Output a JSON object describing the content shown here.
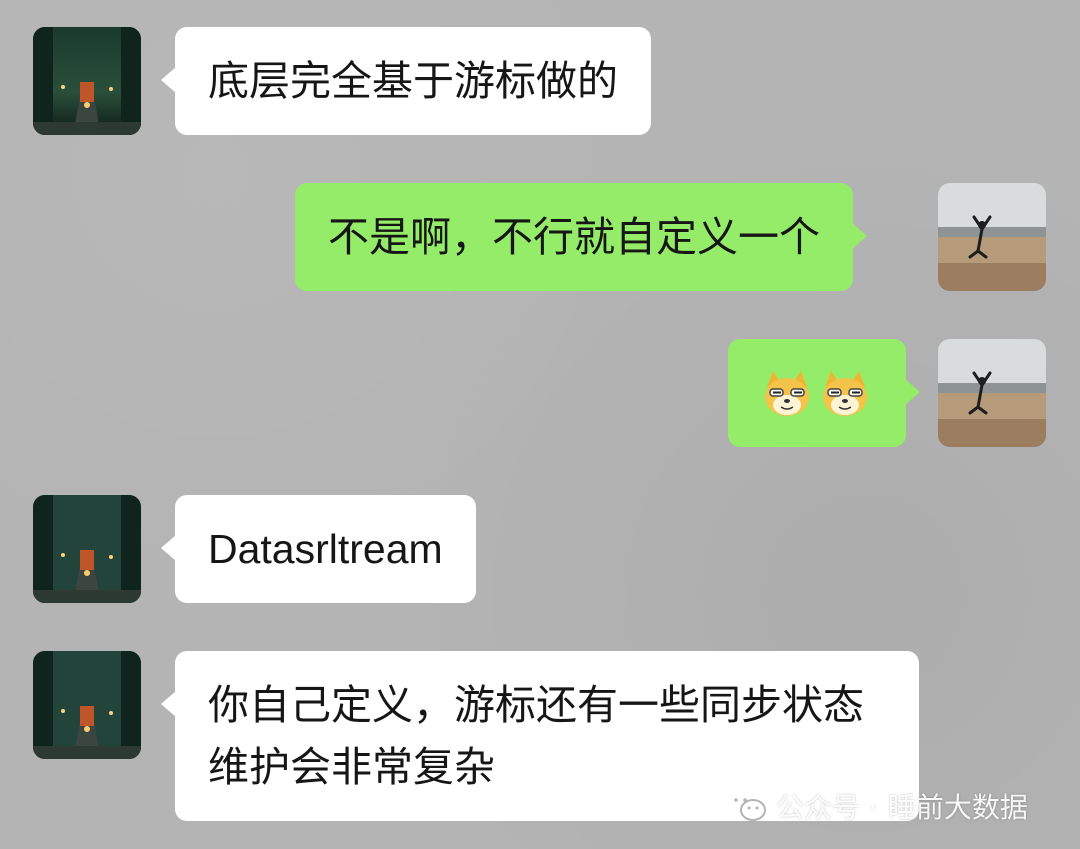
{
  "messages": [
    {
      "side": "left",
      "text": "底层完全基于游标做的"
    },
    {
      "side": "right",
      "text": "不是啊，不行就自定义一个"
    },
    {
      "side": "right",
      "emoji": [
        "doge-emoji",
        "doge-emoji"
      ]
    },
    {
      "side": "left",
      "text": "Datasrltream"
    },
    {
      "side": "left",
      "text": "你自己定义，游标还有一些同步状态维护会非常复杂"
    }
  ],
  "watermark": {
    "prefix": "公众号 ·",
    "name": "睡前大数据",
    "icon": "wechat-icon"
  },
  "colors": {
    "background": "#b4b4b4",
    "left_bubble": "#ffffff",
    "right_bubble": "#95ec69"
  }
}
